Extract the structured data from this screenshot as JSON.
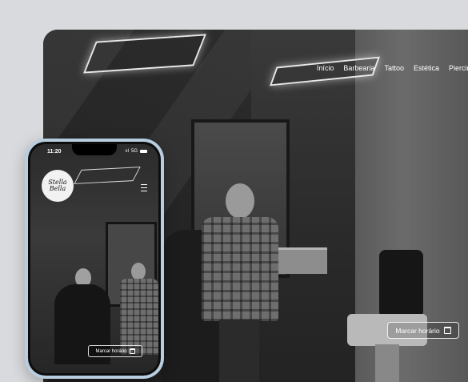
{
  "desktop": {
    "nav": [
      "Início",
      "Barbearia",
      "Tattoo",
      "Estética",
      "Piercings"
    ],
    "cta_label": "Marcar horário",
    "cta_icon": "calendar-icon"
  },
  "phone": {
    "status": {
      "time": "11:20",
      "network": "5G"
    },
    "logo_text": "Stella Bella",
    "menu_icon": "hamburger-menu-icon",
    "cta_label": "Marcar horário",
    "cta_icon": "calendar-icon"
  }
}
